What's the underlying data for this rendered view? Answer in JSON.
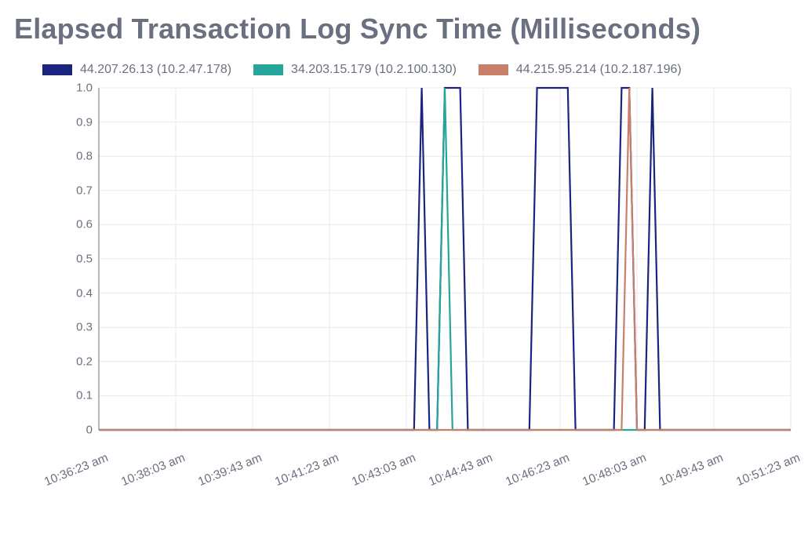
{
  "title": "Elapsed Transaction Log Sync Time (Milliseconds)",
  "colors": {
    "s1": "#1a237e",
    "s2": "#26a69a",
    "s3": "#c77f6a",
    "grid": "#e8e8e8",
    "axis": "#888888",
    "text": "#6a7080"
  },
  "legend": [
    {
      "swatchColorKey": "s1",
      "label": "44.207.26.13 (10.2.47.178)"
    },
    {
      "swatchColorKey": "s2",
      "label": "34.203.15.179 (10.2.100.130)"
    },
    {
      "swatchColorKey": "s3",
      "label": "44.215.95.214 (10.2.187.196)"
    }
  ],
  "yticks": [
    "0",
    "0.1",
    "0.2",
    "0.3",
    "0.4",
    "0.5",
    "0.6",
    "0.7",
    "0.8",
    "0.9",
    "1.0"
  ],
  "xticks": [
    "10:36:23 am",
    "10:38:03 am",
    "10:39:43 am",
    "10:41:23 am",
    "10:43:03 am",
    "10:44:43 am",
    "10:46:23 am",
    "10:48:03 am",
    "10:49:43 am",
    "10:51:23 am"
  ],
  "chart_data": {
    "type": "line",
    "title": "Elapsed Transaction Log Sync Time (Milliseconds)",
    "xlabel": "",
    "ylabel": "",
    "ylim": [
      0,
      1.0
    ],
    "x_start": "10:36:23 am",
    "x_step_seconds": 10,
    "n_points": 91,
    "x_tick_labels": [
      "10:36:23 am",
      "10:38:03 am",
      "10:39:43 am",
      "10:41:23 am",
      "10:43:03 am",
      "10:44:43 am",
      "10:46:23 am",
      "10:48:03 am",
      "10:49:43 am",
      "10:51:23 am"
    ],
    "series": [
      {
        "name": "44.207.26.13 (10.2.47.178)",
        "color": "#1a237e",
        "values": [
          0,
          0,
          0,
          0,
          0,
          0,
          0,
          0,
          0,
          0,
          0,
          0,
          0,
          0,
          0,
          0,
          0,
          0,
          0,
          0,
          0,
          0,
          0,
          0,
          0,
          0,
          0,
          0,
          0,
          0,
          0,
          0,
          0,
          0,
          0,
          0,
          0,
          0,
          0,
          0,
          0,
          0,
          1,
          0,
          0,
          1,
          1,
          1,
          0,
          0,
          0,
          0,
          0,
          0,
          0,
          0,
          0,
          1,
          1,
          1,
          1,
          1,
          0,
          0,
          0,
          0,
          0,
          0,
          1,
          1,
          0,
          0,
          1,
          0,
          0,
          0,
          0,
          0,
          0,
          0,
          0,
          0,
          0,
          0,
          0,
          0,
          0,
          0,
          0,
          0,
          0
        ]
      },
      {
        "name": "34.203.15.179 (10.2.100.130)",
        "color": "#26a69a",
        "values": [
          0,
          0,
          0,
          0,
          0,
          0,
          0,
          0,
          0,
          0,
          0,
          0,
          0,
          0,
          0,
          0,
          0,
          0,
          0,
          0,
          0,
          0,
          0,
          0,
          0,
          0,
          0,
          0,
          0,
          0,
          0,
          0,
          0,
          0,
          0,
          0,
          0,
          0,
          0,
          0,
          0,
          0,
          0,
          0,
          0,
          1,
          0,
          0,
          0,
          0,
          0,
          0,
          0,
          0,
          0,
          0,
          0,
          0,
          0,
          0,
          0,
          0,
          0,
          0,
          0,
          0,
          0,
          0,
          0,
          0,
          0,
          0,
          0,
          0,
          0,
          0,
          0,
          0,
          0,
          0,
          0,
          0,
          0,
          0,
          0,
          0,
          0,
          0,
          0,
          0,
          0
        ]
      },
      {
        "name": "44.215.95.214 (10.2.187.196)",
        "color": "#c77f6a",
        "values": [
          0,
          0,
          0,
          0,
          0,
          0,
          0,
          0,
          0,
          0,
          0,
          0,
          0,
          0,
          0,
          0,
          0,
          0,
          0,
          0,
          0,
          0,
          0,
          0,
          0,
          0,
          0,
          0,
          0,
          0,
          0,
          0,
          0,
          0,
          0,
          0,
          0,
          0,
          0,
          0,
          0,
          0,
          0,
          0,
          0,
          0,
          0,
          0,
          0,
          0,
          0,
          0,
          0,
          0,
          0,
          0,
          0,
          0,
          0,
          0,
          0,
          0,
          0,
          0,
          0,
          0,
          0,
          0,
          0,
          1,
          0,
          0,
          0,
          0,
          0,
          0,
          0,
          0,
          0,
          0,
          0,
          0,
          0,
          0,
          0,
          0,
          0,
          0,
          0,
          0,
          0
        ]
      }
    ]
  }
}
